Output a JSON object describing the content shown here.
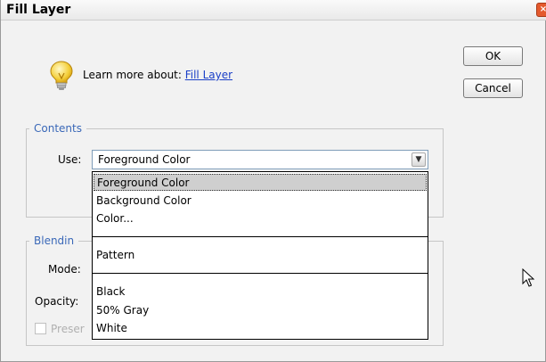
{
  "window": {
    "title": "Fill Layer",
    "close_glyph": "×"
  },
  "buttons": {
    "ok": "OK",
    "cancel": "Cancel"
  },
  "learn_more": {
    "prefix": "Learn more about: ",
    "link": "Fill Layer",
    "icon": "lightbulb-icon"
  },
  "contents": {
    "legend": "Contents",
    "use_label": "Use:",
    "use_value": "Foreground Color"
  },
  "blending": {
    "legend": "Blendin",
    "mode_label": "Mode:",
    "opacity_label": "Opacity:",
    "preserve_label": "Preser"
  },
  "dropdown": {
    "options": [
      "Foreground Color",
      "Background Color",
      "Color...",
      "Pattern",
      "Black",
      "50% Gray",
      "White"
    ],
    "selected": "Foreground Color"
  },
  "colors": {
    "legend": "#3a68b8",
    "link": "#1a3fc7",
    "highlight": "#cfcfcf"
  }
}
